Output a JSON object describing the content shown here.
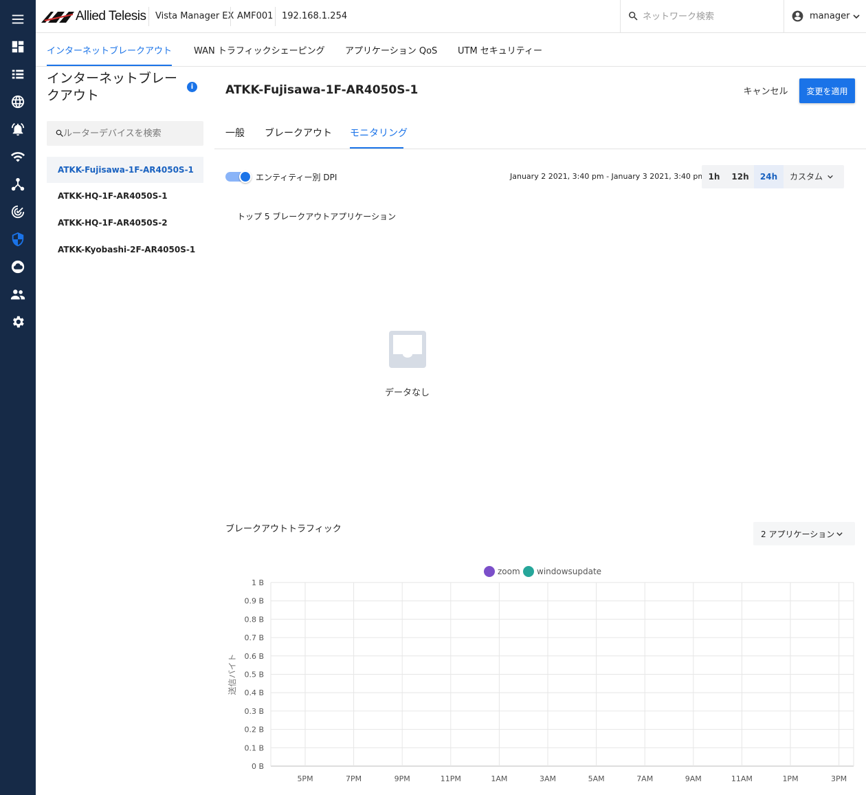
{
  "rail": {
    "icons": [
      "menu-icon",
      "dashboard-icon",
      "list-icon",
      "globe-icon",
      "alarm-icon",
      "wifi-icon",
      "topology-icon",
      "radar-icon",
      "shield-icon",
      "cloud-icon",
      "people-icon",
      "gear-icon"
    ],
    "active": "shield-icon"
  },
  "header": {
    "brand": "Allied Telesis",
    "product": "Vista Manager EX",
    "network": "AMF001",
    "ip": "192.168.1.254",
    "search_placeholder": "ネットワーク検索",
    "user": "manager"
  },
  "feature_tabs": [
    {
      "label": "インターネットブレークアウト",
      "active": true
    },
    {
      "label": "WAN トラフィックシェーピング",
      "active": false
    },
    {
      "label": "アプリケーション QoS",
      "active": false
    },
    {
      "label": "UTM セキュリティー",
      "active": false
    }
  ],
  "left_panel": {
    "title": "インターネットブレークアウト",
    "search_placeholder": "ルーターデバイスを検索",
    "devices": [
      {
        "name": "ATKK-Fujisawa-1F-AR4050S-1",
        "selected": true
      },
      {
        "name": "ATKK-HQ-1F-AR4050S-1",
        "selected": false
      },
      {
        "name": "ATKK-HQ-1F-AR4050S-2",
        "selected": false
      },
      {
        "name": "ATKK-Kyobashi-2F-AR4050S-1",
        "selected": false
      }
    ]
  },
  "main": {
    "title": "ATKK-Fujisawa-1F-AR4050S-1",
    "cancel_label": "キャンセル",
    "apply_label": "変更を適用",
    "tabs": [
      {
        "label": "一般",
        "active": false
      },
      {
        "label": "ブレークアウト",
        "active": false
      },
      {
        "label": "モニタリング",
        "active": true
      }
    ],
    "toggle": {
      "label": "エンティティー別 DPI",
      "on": true
    },
    "date_range": "January 2 2021, 3:40 pm - January 3 2021, 3:40 pm",
    "time_buttons": [
      {
        "label": "1h",
        "active": false
      },
      {
        "label": "12h",
        "active": false
      },
      {
        "label": "24h",
        "active": true
      },
      {
        "label": "カスタム",
        "active": false
      }
    ],
    "top5_title": "トップ 5 ブレークアウトアプリケーション",
    "no_data": "データなし",
    "traffic_title": "ブレークアウトトラフィック",
    "app_select": "2 アプリケーション"
  },
  "chart_data": {
    "type": "line",
    "series": [
      {
        "name": "zoom",
        "color": "#7b4fc9",
        "values": []
      },
      {
        "name": "windowsupdate",
        "color": "#26a69a",
        "values": []
      }
    ],
    "x_tick_labels": [
      "5PM",
      "7PM",
      "9PM",
      "11PM",
      "1AM",
      "3AM",
      "5AM",
      "7AM",
      "9AM",
      "11AM",
      "1PM",
      "3PM"
    ],
    "y_tick_labels": [
      "0 B",
      "0.1 B",
      "0.2 B",
      "0.3 B",
      "0.4 B",
      "0.5 B",
      "0.6 B",
      "0.7 B",
      "0.8 B",
      "0.9 B",
      "1 B"
    ],
    "ylabel": "送信バイト",
    "ylim": [
      0,
      1
    ],
    "grid": true,
    "legend": "top-center"
  }
}
